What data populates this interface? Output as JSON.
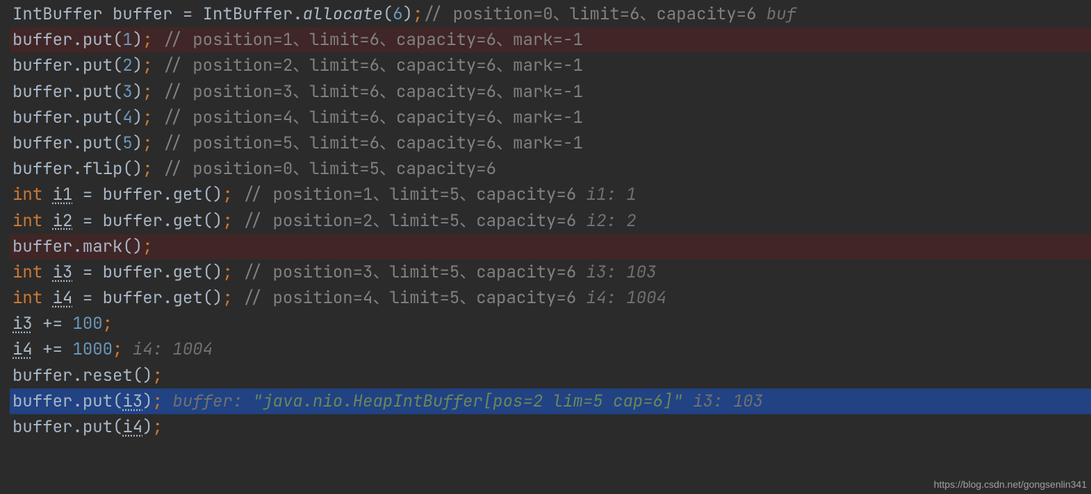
{
  "watermark": "https://blog.csdn.net/gongsenlin341",
  "lines": [
    {
      "hl": "",
      "tokens": [
        {
          "t": "IntBuffer buffer ",
          "cls": "ident"
        },
        {
          "t": "= ",
          "cls": "punct"
        },
        {
          "t": "IntBuffer",
          "cls": "ident"
        },
        {
          "t": ".",
          "cls": "punct"
        },
        {
          "t": "allocate",
          "cls": "static"
        },
        {
          "t": "(",
          "cls": "punct"
        },
        {
          "t": "6",
          "cls": "num"
        },
        {
          "t": ")",
          "cls": "punct"
        },
        {
          "t": ";",
          "cls": "semi"
        },
        {
          "t": "// position=0、limit=6、capacity=6  ",
          "cls": "cmt"
        },
        {
          "t": "buf",
          "cls": "hint"
        }
      ]
    },
    {
      "hl": "hl-red",
      "tokens": [
        {
          "t": "buffer",
          "cls": "ident"
        },
        {
          "t": ".",
          "cls": "punct"
        },
        {
          "t": "put",
          "cls": "method"
        },
        {
          "t": "(",
          "cls": "punct"
        },
        {
          "t": "1",
          "cls": "num"
        },
        {
          "t": ")",
          "cls": "punct"
        },
        {
          "t": ";",
          "cls": "semi"
        },
        {
          "t": " // position=1、limit=6、capacity=6、mark=-1",
          "cls": "cmt"
        }
      ]
    },
    {
      "hl": "",
      "tokens": [
        {
          "t": "buffer",
          "cls": "ident"
        },
        {
          "t": ".",
          "cls": "punct"
        },
        {
          "t": "put",
          "cls": "method"
        },
        {
          "t": "(",
          "cls": "punct"
        },
        {
          "t": "2",
          "cls": "num"
        },
        {
          "t": ")",
          "cls": "punct"
        },
        {
          "t": ";",
          "cls": "semi"
        },
        {
          "t": " // position=2、limit=6、capacity=6、mark=-1",
          "cls": "cmt"
        }
      ]
    },
    {
      "hl": "",
      "tokens": [
        {
          "t": "buffer",
          "cls": "ident"
        },
        {
          "t": ".",
          "cls": "punct"
        },
        {
          "t": "put",
          "cls": "method"
        },
        {
          "t": "(",
          "cls": "punct"
        },
        {
          "t": "3",
          "cls": "num"
        },
        {
          "t": ")",
          "cls": "punct"
        },
        {
          "t": ";",
          "cls": "semi"
        },
        {
          "t": " // position=3、limit=6、capacity=6、mark=-1",
          "cls": "cmt"
        }
      ]
    },
    {
      "hl": "",
      "tokens": [
        {
          "t": "buffer",
          "cls": "ident"
        },
        {
          "t": ".",
          "cls": "punct"
        },
        {
          "t": "put",
          "cls": "method"
        },
        {
          "t": "(",
          "cls": "punct"
        },
        {
          "t": "4",
          "cls": "num"
        },
        {
          "t": ")",
          "cls": "punct"
        },
        {
          "t": ";",
          "cls": "semi"
        },
        {
          "t": " // position=4、limit=6、capacity=6、mark=-1",
          "cls": "cmt"
        }
      ]
    },
    {
      "hl": "",
      "tokens": [
        {
          "t": "buffer",
          "cls": "ident"
        },
        {
          "t": ".",
          "cls": "punct"
        },
        {
          "t": "put",
          "cls": "method"
        },
        {
          "t": "(",
          "cls": "punct"
        },
        {
          "t": "5",
          "cls": "num"
        },
        {
          "t": ")",
          "cls": "punct"
        },
        {
          "t": ";",
          "cls": "semi"
        },
        {
          "t": " // position=5、limit=6、capacity=6、mark=-1",
          "cls": "cmt"
        }
      ]
    },
    {
      "hl": "",
      "tokens": [
        {
          "t": "buffer",
          "cls": "ident"
        },
        {
          "t": ".",
          "cls": "punct"
        },
        {
          "t": "flip",
          "cls": "method"
        },
        {
          "t": "()",
          "cls": "punct"
        },
        {
          "t": ";",
          "cls": "semi"
        },
        {
          "t": " // position=0、limit=5、capacity=6",
          "cls": "cmt"
        }
      ]
    },
    {
      "hl": "",
      "tokens": [
        {
          "t": "int ",
          "cls": "kw"
        },
        {
          "t": "i1",
          "cls": "var"
        },
        {
          "t": " = ",
          "cls": "punct"
        },
        {
          "t": "buffer",
          "cls": "ident"
        },
        {
          "t": ".",
          "cls": "punct"
        },
        {
          "t": "get",
          "cls": "method"
        },
        {
          "t": "()",
          "cls": "punct"
        },
        {
          "t": ";",
          "cls": "semi"
        },
        {
          "t": " // position=1、limit=5、capacity=6  ",
          "cls": "cmt"
        },
        {
          "t": "i1: 1",
          "cls": "hint"
        }
      ]
    },
    {
      "hl": "",
      "tokens": [
        {
          "t": "int ",
          "cls": "kw"
        },
        {
          "t": "i2",
          "cls": "var"
        },
        {
          "t": " = ",
          "cls": "punct"
        },
        {
          "t": "buffer",
          "cls": "ident"
        },
        {
          "t": ".",
          "cls": "punct"
        },
        {
          "t": "get",
          "cls": "method"
        },
        {
          "t": "()",
          "cls": "punct"
        },
        {
          "t": ";",
          "cls": "semi"
        },
        {
          "t": " // position=2、limit=5、capacity=6  ",
          "cls": "cmt"
        },
        {
          "t": "i2: 2",
          "cls": "hint"
        }
      ]
    },
    {
      "hl": "hl-red",
      "tokens": [
        {
          "t": "buffer",
          "cls": "ident"
        },
        {
          "t": ".",
          "cls": "punct"
        },
        {
          "t": "mark",
          "cls": "method"
        },
        {
          "t": "()",
          "cls": "punct"
        },
        {
          "t": ";",
          "cls": "semi"
        }
      ]
    },
    {
      "hl": "",
      "tokens": [
        {
          "t": "int ",
          "cls": "kw"
        },
        {
          "t": "i3",
          "cls": "var"
        },
        {
          "t": " = ",
          "cls": "punct"
        },
        {
          "t": "buffer",
          "cls": "ident"
        },
        {
          "t": ".",
          "cls": "punct"
        },
        {
          "t": "get",
          "cls": "method"
        },
        {
          "t": "()",
          "cls": "punct"
        },
        {
          "t": ";",
          "cls": "semi"
        },
        {
          "t": " // position=3、limit=5、capacity=6  ",
          "cls": "cmt"
        },
        {
          "t": "i3: 103",
          "cls": "hint"
        }
      ]
    },
    {
      "hl": "",
      "tokens": [
        {
          "t": "int ",
          "cls": "kw"
        },
        {
          "t": "i4",
          "cls": "var"
        },
        {
          "t": " = ",
          "cls": "punct"
        },
        {
          "t": "buffer",
          "cls": "ident"
        },
        {
          "t": ".",
          "cls": "punct"
        },
        {
          "t": "get",
          "cls": "method"
        },
        {
          "t": "()",
          "cls": "punct"
        },
        {
          "t": ";",
          "cls": "semi"
        },
        {
          "t": " // position=4、limit=5、capacity=6  ",
          "cls": "cmt"
        },
        {
          "t": "i4: 1004",
          "cls": "hint"
        }
      ]
    },
    {
      "hl": "",
      "tokens": [
        {
          "t": "i3",
          "cls": "var"
        },
        {
          "t": " += ",
          "cls": "punct"
        },
        {
          "t": "100",
          "cls": "num"
        },
        {
          "t": ";",
          "cls": "semi"
        }
      ]
    },
    {
      "hl": "",
      "tokens": [
        {
          "t": "i4",
          "cls": "var"
        },
        {
          "t": " += ",
          "cls": "punct"
        },
        {
          "t": "1000",
          "cls": "num"
        },
        {
          "t": ";",
          "cls": "semi"
        },
        {
          "t": "  i4: 1004",
          "cls": "hint"
        }
      ]
    },
    {
      "hl": "",
      "tokens": [
        {
          "t": "buffer",
          "cls": "ident"
        },
        {
          "t": ".",
          "cls": "punct"
        },
        {
          "t": "reset",
          "cls": "method"
        },
        {
          "t": "()",
          "cls": "punct"
        },
        {
          "t": ";",
          "cls": "semi"
        }
      ]
    },
    {
      "hl": "hl-blue",
      "tokens": [
        {
          "t": "buffer",
          "cls": "ident"
        },
        {
          "t": ".",
          "cls": "punct"
        },
        {
          "t": "put",
          "cls": "method"
        },
        {
          "t": "(",
          "cls": "punct"
        },
        {
          "t": "i3",
          "cls": "var"
        },
        {
          "t": ")",
          "cls": "punct"
        },
        {
          "t": ";",
          "cls": "semi"
        },
        {
          "t": "  buffer: ",
          "cls": "hint"
        },
        {
          "t": "\"java.nio.HeapIntBuffer[pos=2 lim=5 cap=6]\"",
          "cls": "str"
        },
        {
          "t": "  i3: 103",
          "cls": "hint"
        }
      ]
    },
    {
      "hl": "",
      "tokens": [
        {
          "t": "buffer",
          "cls": "ident"
        },
        {
          "t": ".",
          "cls": "punct"
        },
        {
          "t": "put",
          "cls": "method"
        },
        {
          "t": "(",
          "cls": "punct"
        },
        {
          "t": "i4",
          "cls": "var"
        },
        {
          "t": ")",
          "cls": "punct"
        },
        {
          "t": ";",
          "cls": "semi"
        }
      ]
    }
  ]
}
